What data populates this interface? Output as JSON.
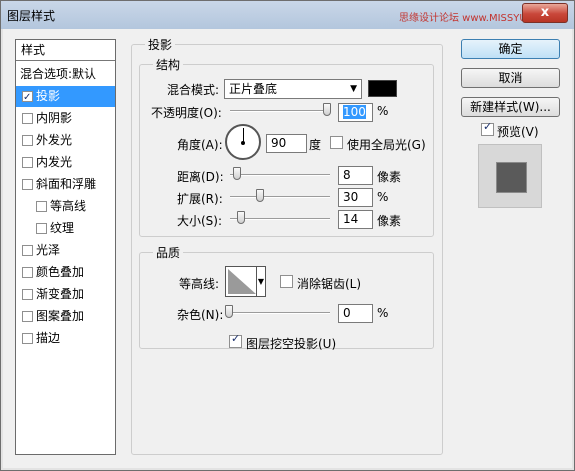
{
  "window": {
    "title": "图层样式",
    "watermark": "思缘设计论坛 www.MISSYUAN.COM",
    "close_label": "x"
  },
  "style_list": {
    "header": "样式",
    "blend_options": "混合选项:默认",
    "items": [
      {
        "label": "投影",
        "checked": true,
        "selected": true
      },
      {
        "label": "内阴影",
        "checked": false
      },
      {
        "label": "外发光",
        "checked": false
      },
      {
        "label": "内发光",
        "checked": false
      },
      {
        "label": "斜面和浮雕",
        "checked": false
      },
      {
        "label": "等高线",
        "checked": false,
        "indent": true
      },
      {
        "label": "纹理",
        "checked": false,
        "indent": true
      },
      {
        "label": "光泽",
        "checked": false
      },
      {
        "label": "颜色叠加",
        "checked": false
      },
      {
        "label": "渐变叠加",
        "checked": false
      },
      {
        "label": "图案叠加",
        "checked": false
      },
      {
        "label": "描边",
        "checked": false
      }
    ]
  },
  "drop_shadow": {
    "section_title": "投影",
    "structure": {
      "title": "结构",
      "blend_mode_label": "混合模式:",
      "blend_mode_value": "正片叠底",
      "shadow_color": "#000000",
      "opacity_label": "不透明度(O):",
      "opacity_value": "100",
      "opacity_unit": "%",
      "angle_label": "角度(A):",
      "angle_value": "90",
      "angle_unit": "度",
      "global_light_label": "使用全局光(G)",
      "global_light_checked": false,
      "distance_label": "距离(D):",
      "distance_value": "8",
      "distance_unit": "像素",
      "spread_label": "扩展(R):",
      "spread_value": "30",
      "spread_unit": "%",
      "size_label": "大小(S):",
      "size_value": "14",
      "size_unit": "像素"
    },
    "quality": {
      "title": "品质",
      "contour_label": "等高线:",
      "anti_alias_label": "消除锯齿(L)",
      "anti_alias_checked": false,
      "noise_label": "杂色(N):",
      "noise_value": "0",
      "noise_unit": "%"
    },
    "knockout_label": "图层挖空投影(U)",
    "knockout_checked": true
  },
  "buttons": {
    "ok": "确定",
    "cancel": "取消",
    "new_style": "新建样式(W)...",
    "preview_label": "预览(V)",
    "preview_checked": true
  }
}
